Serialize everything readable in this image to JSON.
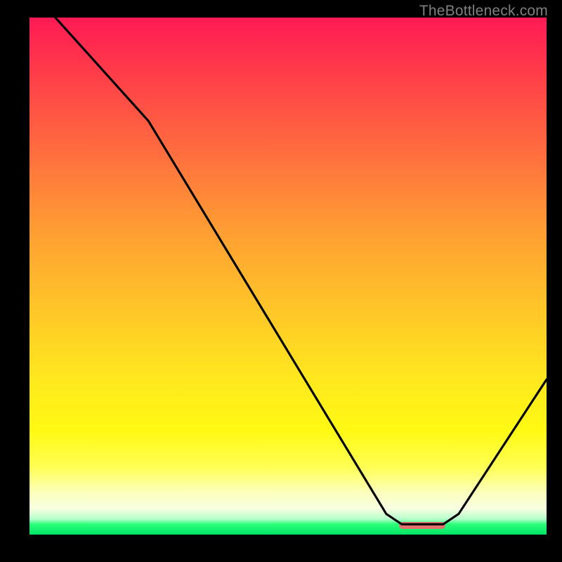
{
  "watermark": "TheBottleneck.com",
  "colors": {
    "background": "#000000",
    "axis": "#000000",
    "curve": "#000000",
    "marker": "#e0736f",
    "gradient_top": "#ff1a55",
    "gradient_bottom": "#00e465",
    "watermark_text": "#7f7f7f"
  },
  "marker": {
    "x_start_frac": 0.715,
    "x_end_frac": 0.805,
    "y_frac": 0.977
  },
  "chart_data": {
    "type": "line",
    "title": "",
    "xlabel": "",
    "ylabel": "",
    "xlim": [
      0,
      100
    ],
    "ylim": [
      0,
      100
    ],
    "x": [
      0,
      5,
      23,
      69,
      72,
      80,
      83,
      100
    ],
    "values": [
      110,
      100,
      80,
      4,
      2,
      2,
      4,
      30
    ],
    "annotations": [
      {
        "text": "TheBottleneck.com",
        "role": "watermark",
        "position": "top-right"
      }
    ],
    "notes": "Curve starts above the visible frame at x=0 (y≈110 on a 0–100 scale), descends steeply with a slope change near x≈23, reaches a flat minimum across x≈72–80 at y≈2, then rises to y≈30 at x=100. Background is a red→green vertical gradient. A short salmon rounded bar marks the minimum segment."
  }
}
